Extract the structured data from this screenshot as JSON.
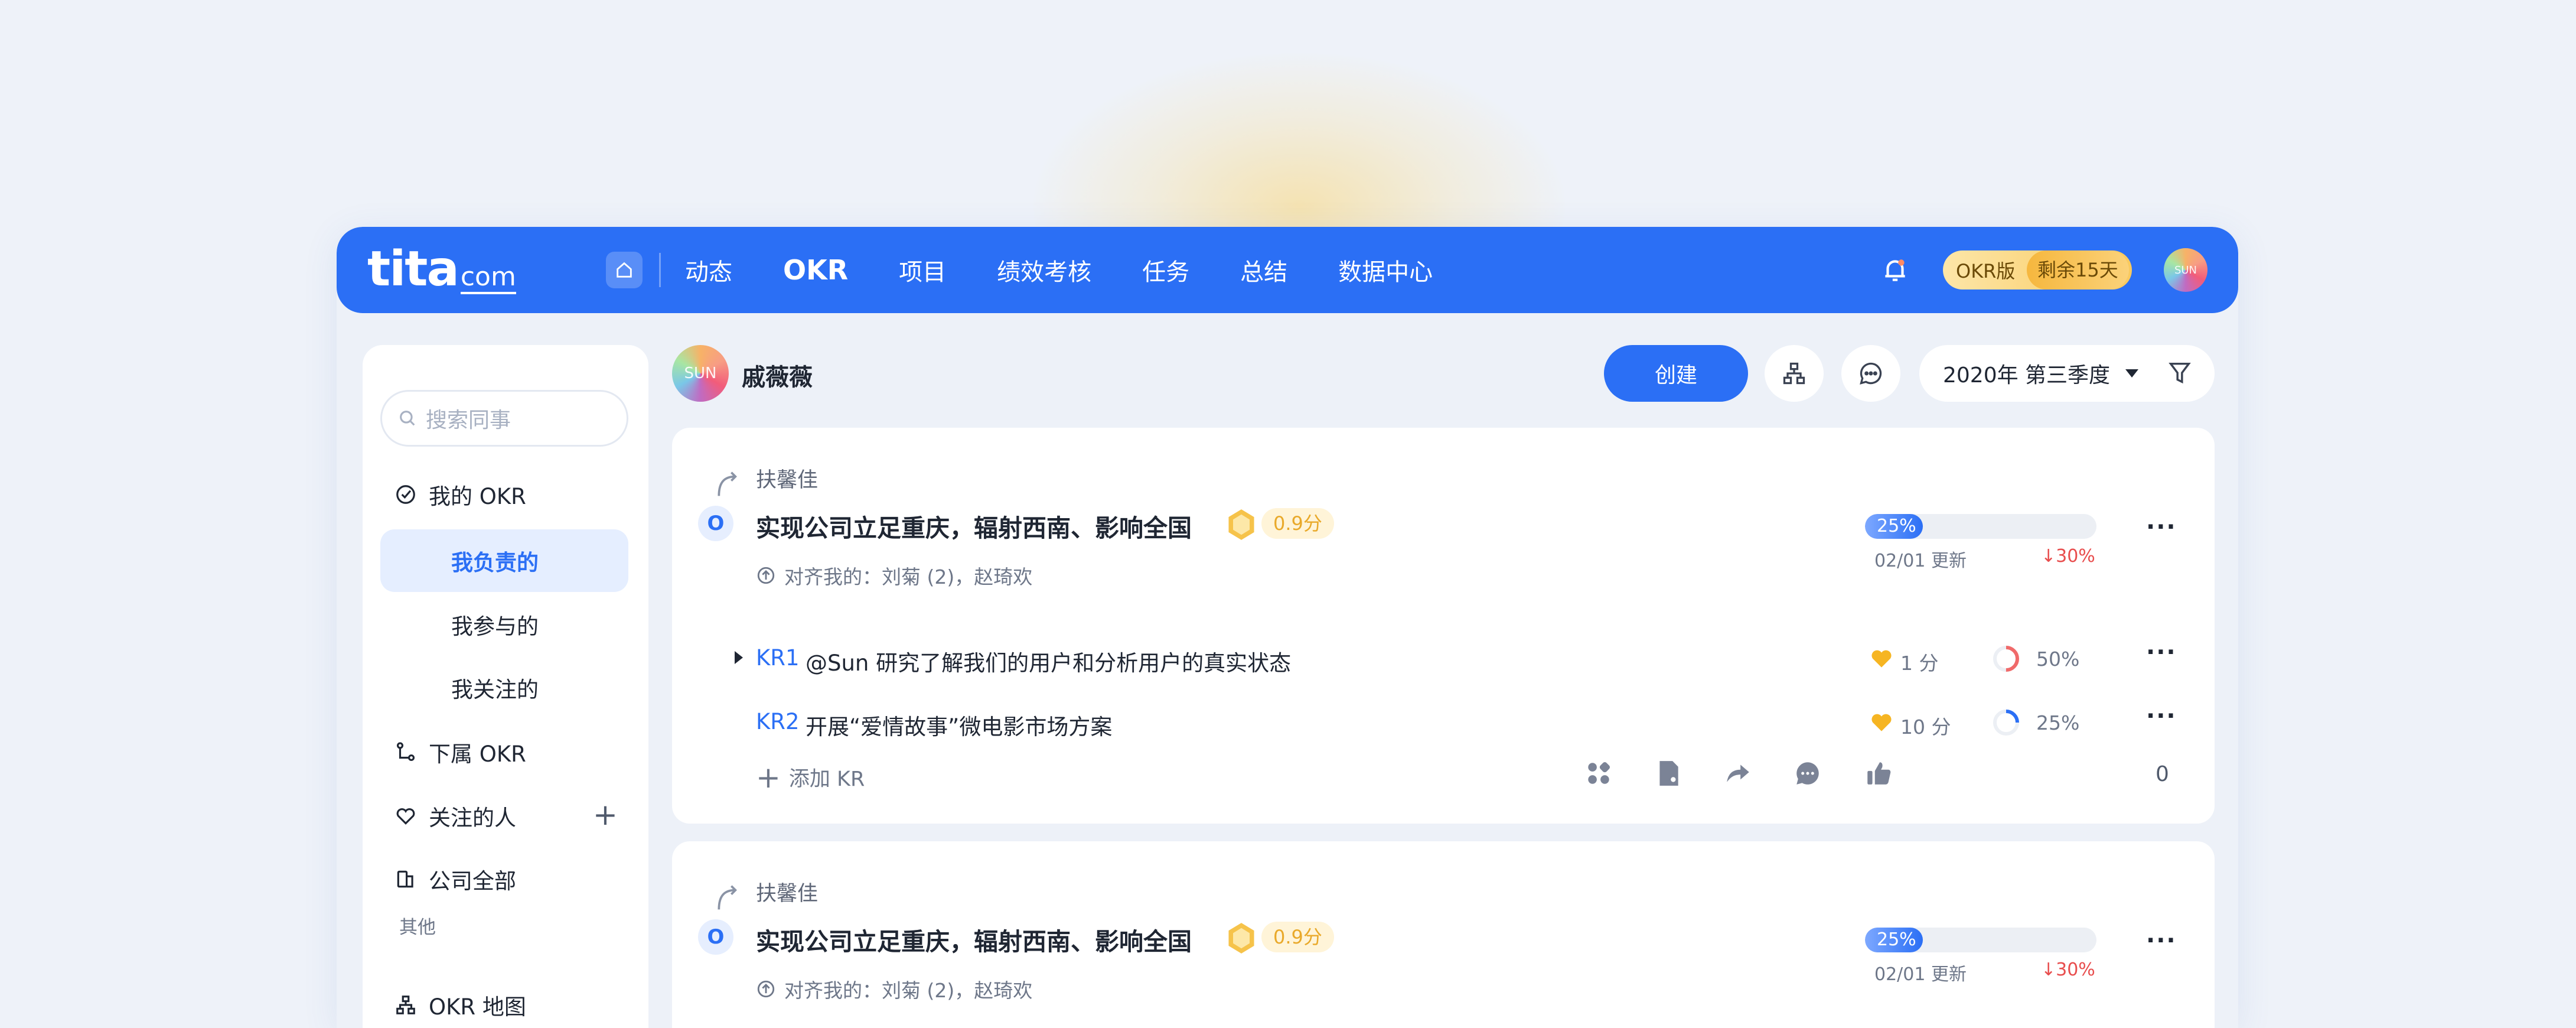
{
  "topnav": {
    "logo_main": "tita",
    "logo_suffix": "com",
    "items": [
      "动态",
      "OKR",
      "项目",
      "绩效考核",
      "任务",
      "总结",
      "数据中心"
    ],
    "active_index": 1,
    "badge_label": "OKR版",
    "badge_remaining": "剩余15天",
    "avatar_text": "SUN"
  },
  "sidebar": {
    "search_placeholder": "搜索同事",
    "my_okr": "我的 OKR",
    "subitems": [
      "我负责的",
      "我参与的",
      "我关注的"
    ],
    "active_sub": 0,
    "sub_okr": "下属 OKR",
    "following": "关注的人",
    "company": "公司全部",
    "other_caption": "其他",
    "okr_map": "OKR 地图"
  },
  "header": {
    "avatar_text": "SUN",
    "user_name": "戚薇薇",
    "create_label": "创建",
    "period": "2020年 第三季度"
  },
  "cards": [
    {
      "parent": "扶馨佳",
      "o_label": "O",
      "title": "实现公司立足重庆，辐射西南、影响全国",
      "score": "0.9分",
      "align": "对齐我的：刘菊 (2)，赵琦欢",
      "progress_label": "25%",
      "progress_value": 0.25,
      "updated": "02/01 更新",
      "delta": "↓30%",
      "krs": [
        {
          "code": "KR1",
          "text": "@Sun 研究了解我们的用户和分析用户的真实状态",
          "score": "1 分",
          "pct": "50%",
          "pct_value": 0.5,
          "ring_color": "#f06a6a"
        },
        {
          "code": "KR2",
          "text": "开展“爱情故事”微电影市场方案",
          "score": "10 分",
          "pct": "25%",
          "pct_value": 0.25,
          "ring_color": "#2b6ff5"
        }
      ],
      "add_kr": "添加 KR",
      "likes": "0"
    },
    {
      "parent": "扶馨佳",
      "o_label": "O",
      "title": "实现公司立足重庆，辐射西南、影响全国",
      "score": "0.9分",
      "align": "对齐我的：刘菊 (2)，赵琦欢",
      "progress_label": "25%",
      "progress_value": 0.25,
      "updated": "02/01 更新",
      "delta": "↓30%"
    }
  ],
  "colors": {
    "primary": "#2b6ff5",
    "danger": "#e84d4d",
    "score": "#e9a92a"
  }
}
